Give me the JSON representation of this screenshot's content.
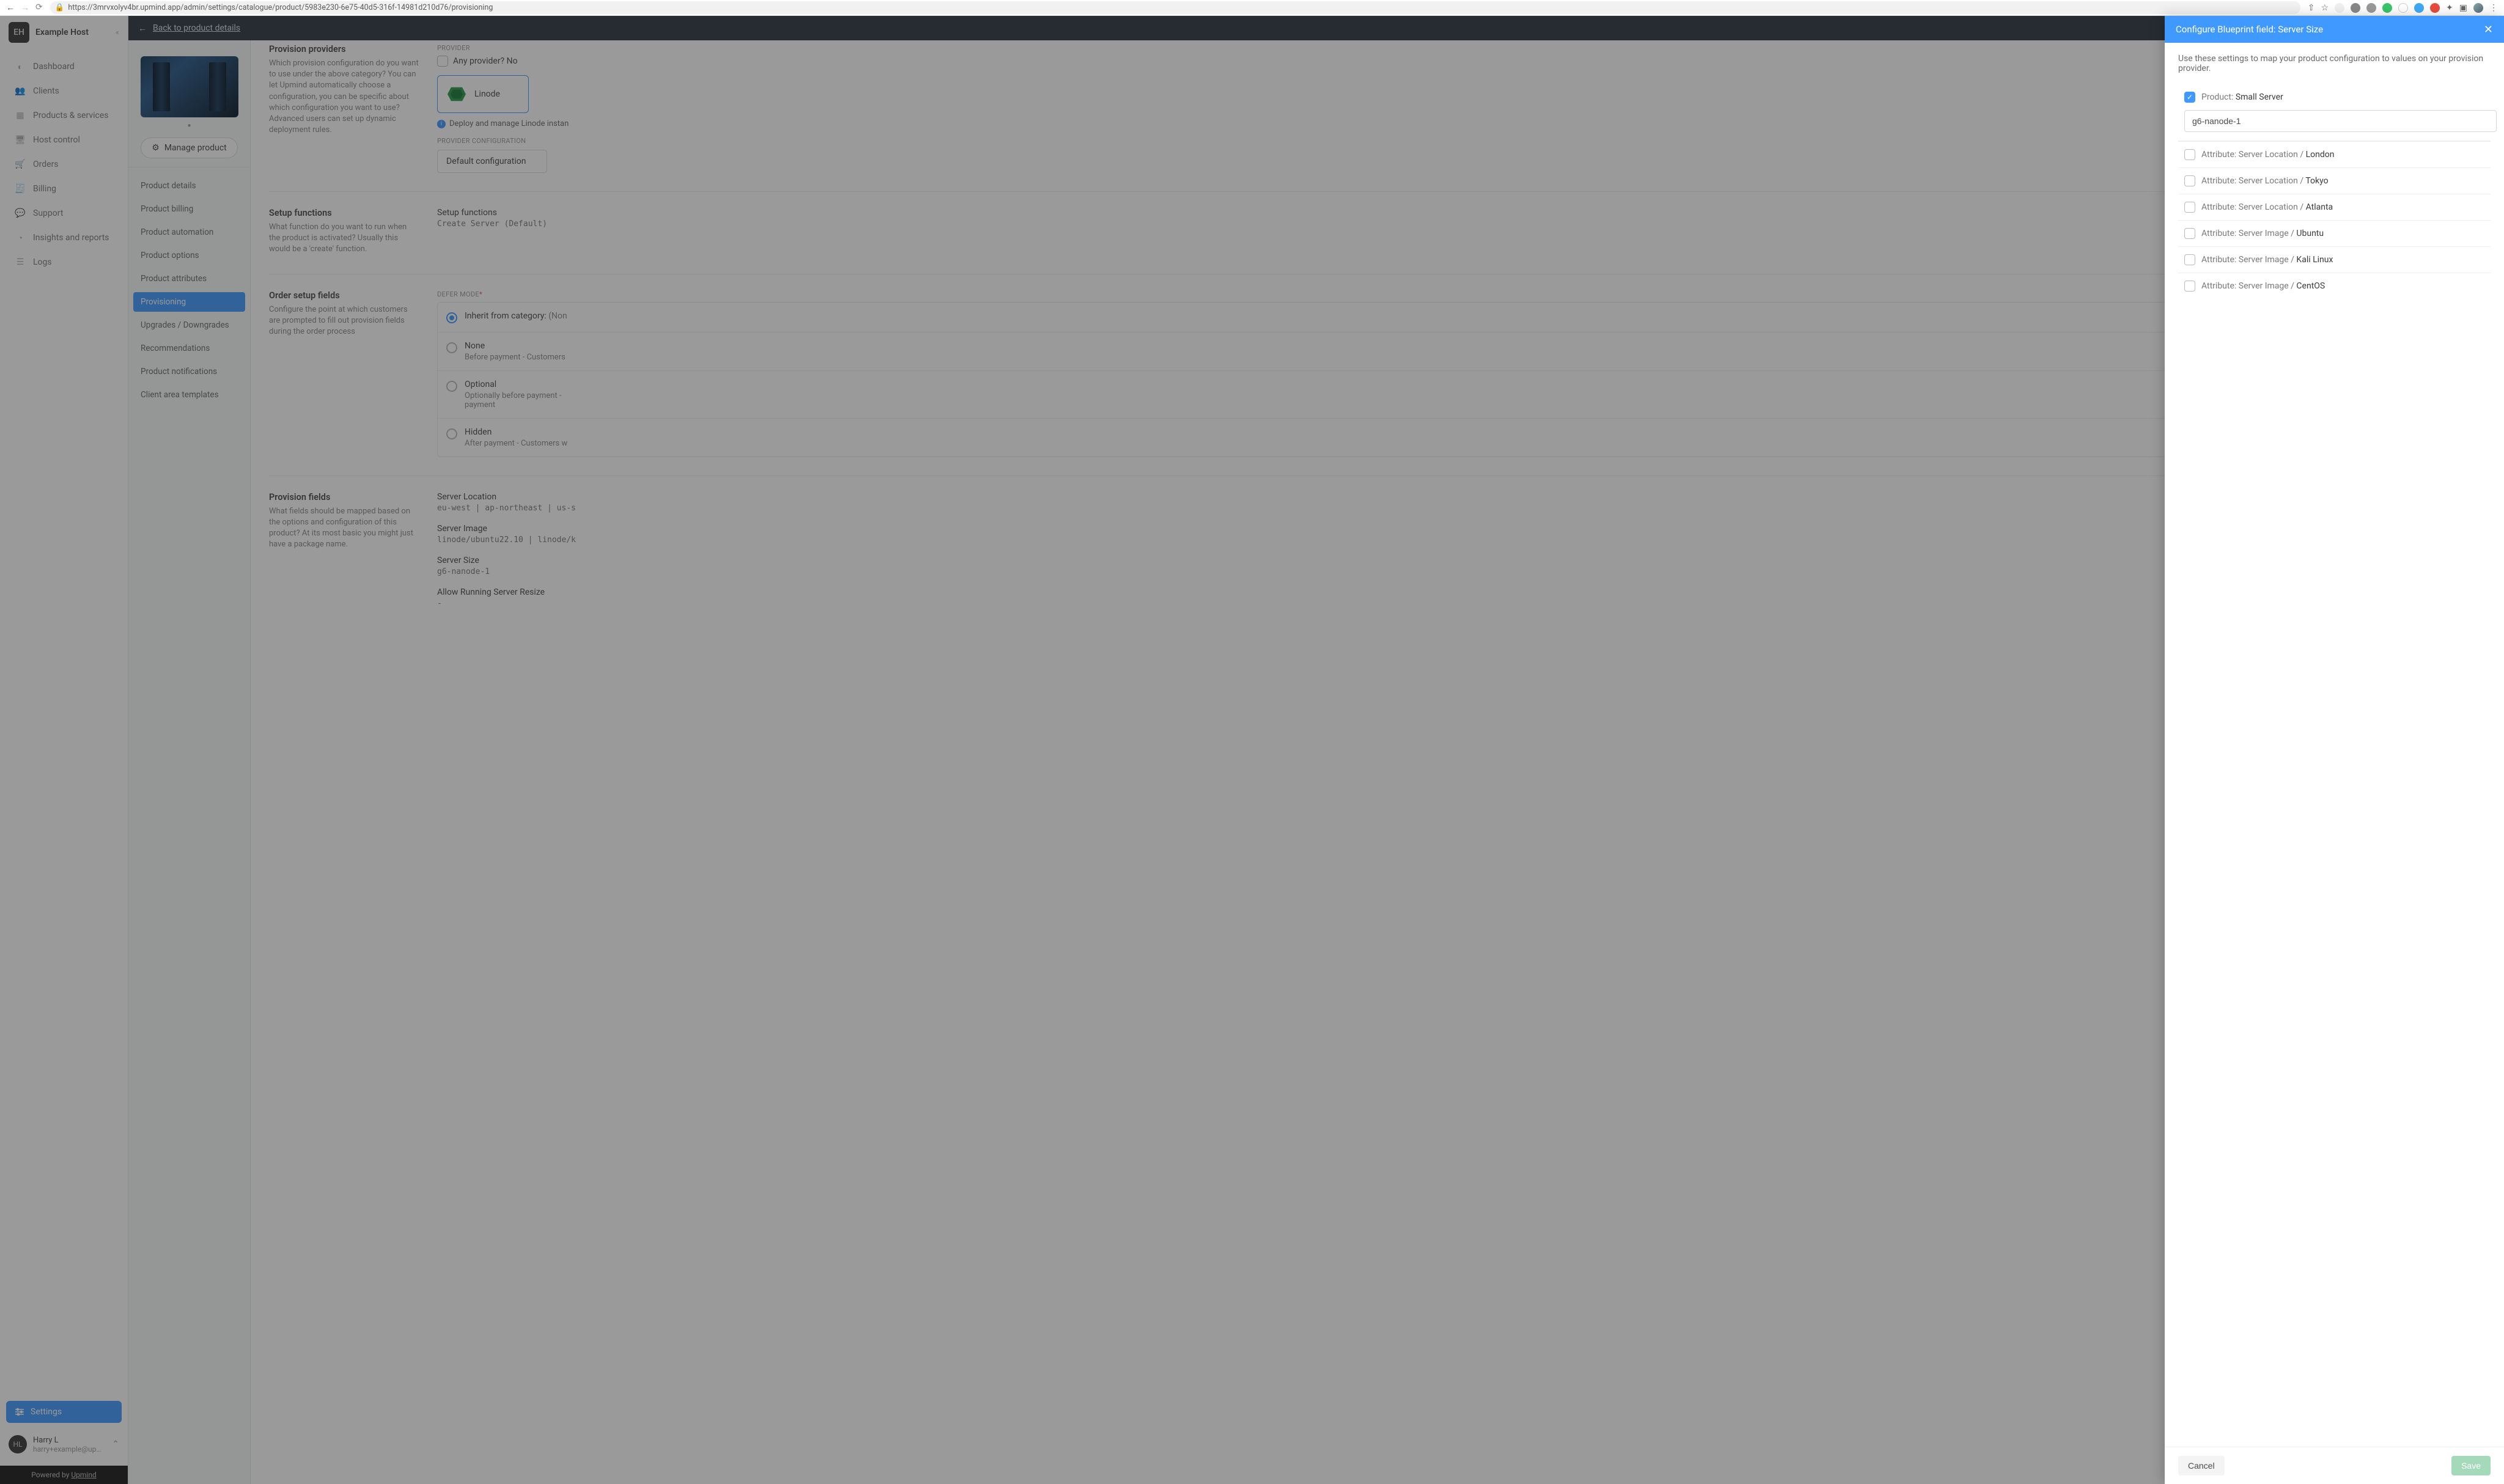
{
  "url": "https://3mrvxolyv4br.upmind.app/admin/settings/catalogue/product/5983e230-6e75-40d5-316f-14981d210d76/provisioning",
  "brand": {
    "initials": "EH",
    "name": "Example Host"
  },
  "nav": [
    {
      "label": "Dashboard"
    },
    {
      "label": "Clients"
    },
    {
      "label": "Products & services"
    },
    {
      "label": "Host control"
    },
    {
      "label": "Orders"
    },
    {
      "label": "Billing"
    },
    {
      "label": "Support"
    },
    {
      "label": "Insights and reports"
    },
    {
      "label": "Logs"
    }
  ],
  "settings_label": "Settings",
  "user": {
    "initials": "HL",
    "name": "Harry L",
    "email": "harry+example@upmind...."
  },
  "powered": {
    "prefix": "Powered by ",
    "name": "Upmind"
  },
  "topbar": {
    "back": "Back to product details"
  },
  "manage_btn": "Manage product",
  "subnav": [
    "Product details",
    "Product billing",
    "Product automation",
    "Product options",
    "Product attributes",
    "Provisioning",
    "Upgrades / Downgrades",
    "Recommendations",
    "Product notifications",
    "Client area templates"
  ],
  "subnav_active_index": 5,
  "sections": {
    "providers": {
      "title": "Provision providers",
      "desc": "Which provision configuration do you want to use under the above category? You can let Upmind automatically choose a configuration, you can be specific about which configuration you want to use? Advanced users can set up dynamic deployment rules.",
      "provider_label": "PROVIDER",
      "any_label": "Any provider?",
      "any_value": "No",
      "provider_name": "Linode",
      "info": "Deploy and manage Linode instan",
      "config_label": "PROVIDER CONFIGURATION",
      "config_value": "Default configuration"
    },
    "setup": {
      "title": "Setup functions",
      "desc": "What function do you want to run when the product is activated? Usually this would be a 'create' function.",
      "right_title": "Setup functions",
      "right_value": "Create Server (Default)"
    },
    "order": {
      "title": "Order setup fields",
      "desc": "Configure the point at which customers are prompted to fill out provision fields during the order process",
      "defer_label": "DEFER MODE",
      "options": [
        {
          "label": "Inherit from category:",
          "suffix": " (Non",
          "sub": "",
          "checked": true
        },
        {
          "label": "None",
          "sub": "Before payment - Customers",
          "checked": false
        },
        {
          "label": "Optional",
          "sub": "Optionally before payment -\npayment",
          "checked": false
        },
        {
          "label": "Hidden",
          "sub": "After payment - Customers w",
          "checked": false
        }
      ]
    },
    "fields": {
      "title": "Provision fields",
      "desc": "What fields should be mapped based on the options and configuration of this product? At its most basic you might just have a package name.",
      "items": [
        {
          "title": "Server Location",
          "value": "eu-west | ap-northeast | us-s"
        },
        {
          "title": "Server Image",
          "value": "linode/ubuntu22.10 | linode/k"
        },
        {
          "title": "Server Size",
          "value": "g6-nanode-1"
        },
        {
          "title": "Allow Running Server Resize",
          "value": "-"
        }
      ]
    }
  },
  "panel": {
    "title": "Configure Blueprint field: Server Size",
    "intro": "Use these settings to map your product configuration to values on your provision provider.",
    "entries": [
      {
        "kind": "Product",
        "name": "Small Server",
        "checked": true,
        "input": "g6-nanode-1"
      },
      {
        "kind": "Attribute",
        "path": "Server Location",
        "name": "London",
        "checked": false
      },
      {
        "kind": "Attribute",
        "path": "Server Location",
        "name": "Tokyo",
        "checked": false
      },
      {
        "kind": "Attribute",
        "path": "Server Location",
        "name": "Atlanta",
        "checked": false
      },
      {
        "kind": "Attribute",
        "path": "Server Image",
        "name": "Ubuntu",
        "checked": false
      },
      {
        "kind": "Attribute",
        "path": "Server Image",
        "name": "Kali Linux",
        "checked": false
      },
      {
        "kind": "Attribute",
        "path": "Server Image",
        "name": "CentOS",
        "checked": false
      }
    ],
    "cancel": "Cancel",
    "save": "Save"
  }
}
